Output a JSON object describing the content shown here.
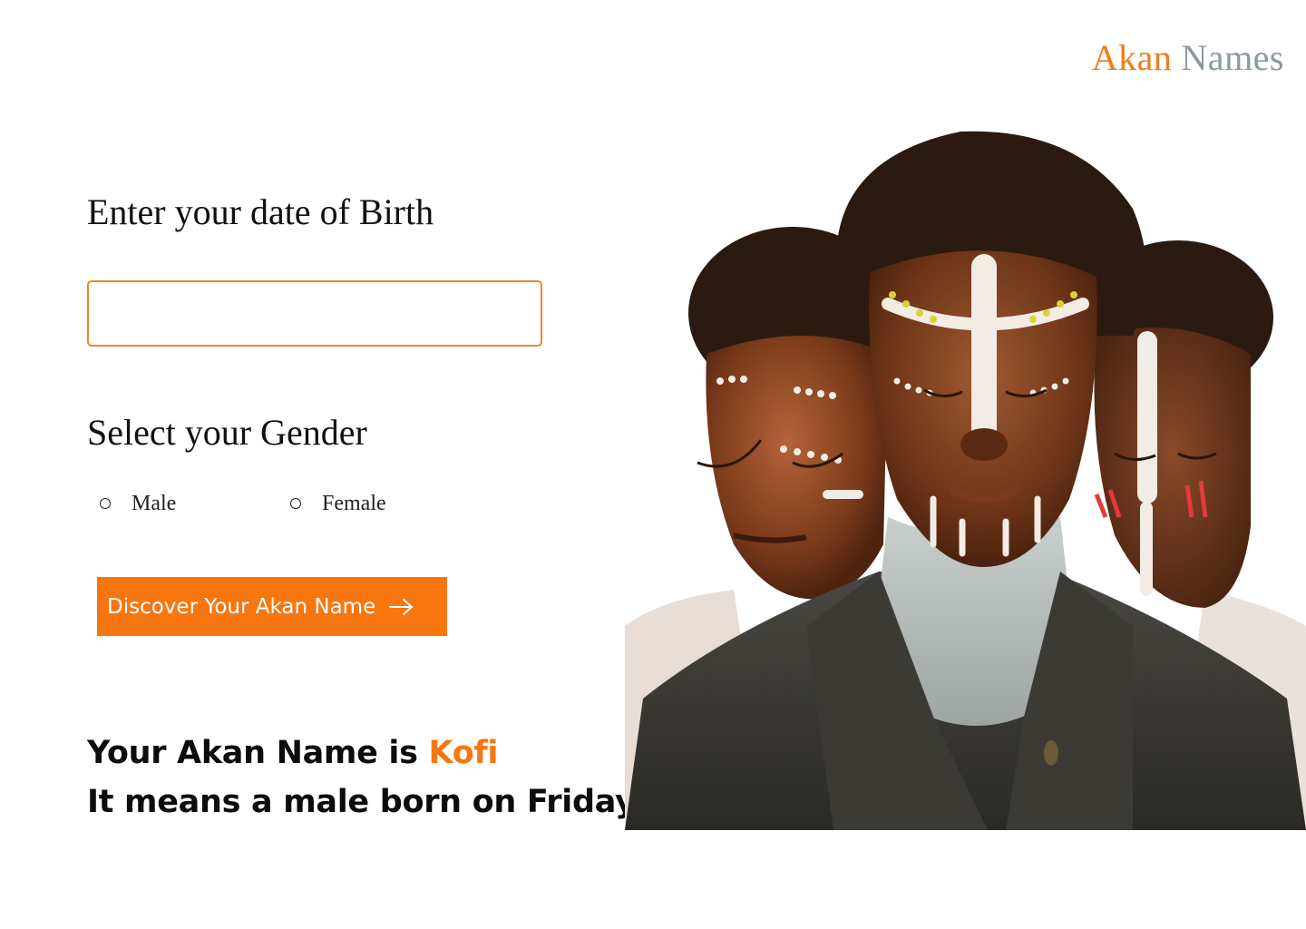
{
  "brand": {
    "part1": "Akan",
    "part2": "Names",
    "color_part1": "#f07d1b",
    "color_part2": "#8d9aa0"
  },
  "form": {
    "dob_label": "Enter your date of Birth",
    "dob_value": "",
    "gender_label": "Select your Gender",
    "gender_options": [
      "Male",
      "Female"
    ],
    "submit_label": "Discover Your Akan Name",
    "submit_icon": "arrow-right-icon"
  },
  "result": {
    "prefix": "Your Akan Name is",
    "name": "Kofi",
    "meaning": "It means a male born on Friday"
  },
  "colors": {
    "accent": "#f7760f",
    "input_border": "#e8882e"
  },
  "hero_image": {
    "icon": "three-men-face-paint-photo"
  }
}
